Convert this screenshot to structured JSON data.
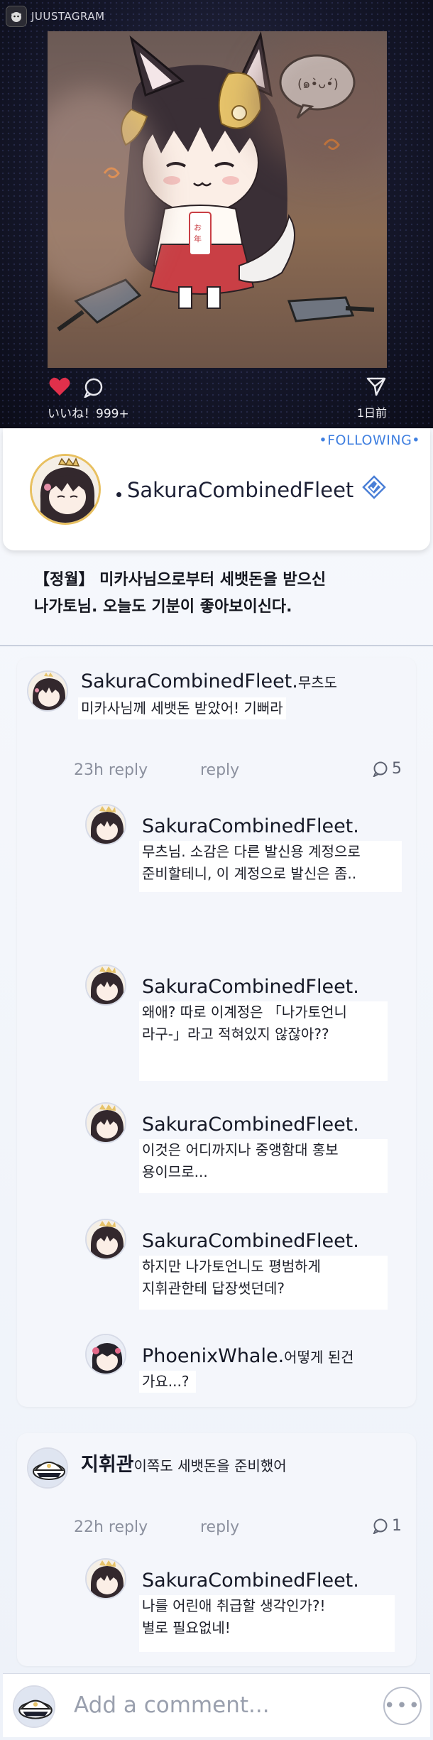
{
  "app": {
    "brand": "JUUSTAGRAM"
  },
  "post": {
    "likes": "いいね！999+",
    "date": "1日前"
  },
  "profile": {
    "following": "•FOLLOWING•",
    "handle": "SakuraCombinedFleet",
    "caption_line1": "【정월】 미카사님으로부터 세뱃돈을 받으신",
    "caption_line2": "나가토님. 오늘도 기분이 좋아보이신다."
  },
  "thread1": {
    "root": {
      "name": "SakuraCombinedFleet.",
      "text_inline": "무츠도",
      "text_line2": "미카사님께 세뱃돈 받았어! 기뻐라",
      "time": "23h reply",
      "reply": "reply",
      "count": "5"
    },
    "replies": [
      {
        "name": "SakuraCombinedFleet.",
        "line1": "무츠님. 소감은 다른 발신용 계정으로",
        "line2": "준비할테니, 이 계정으로 발신은 좀.."
      },
      {
        "name": "SakuraCombinedFleet.",
        "line1": "왜애? 따로 이계정은 「나가토언니",
        "line2": "라구-」라고 적혀있지 않잖아??"
      },
      {
        "name": "SakuraCombinedFleet.",
        "line1": "이것은 어디까지나 중앵함대 홍보",
        "line2": "용이므로..."
      },
      {
        "name": "SakuraCombinedFleet.",
        "line1": "하지만 나가토언니도 평범하게",
        "line2": "지휘관한테 답장썻던데?"
      },
      {
        "name": "PhoenixWhale.",
        "inline": "어떻게 된건",
        "line2": "가요...?"
      }
    ]
  },
  "thread2": {
    "root": {
      "name": "지휘관",
      "text_inline": "이쪽도 세뱃돈을 준비했어",
      "time": "22h reply",
      "reply": "reply",
      "count": "1"
    },
    "replies": [
      {
        "name": "SakuraCombinedFleet.",
        "line1": "나를 어린애 취급할 생각인가?!",
        "line2": "별로 필요없네!"
      }
    ]
  },
  "footer": {
    "placeholder": "Add a comment...",
    "more": "•••"
  }
}
